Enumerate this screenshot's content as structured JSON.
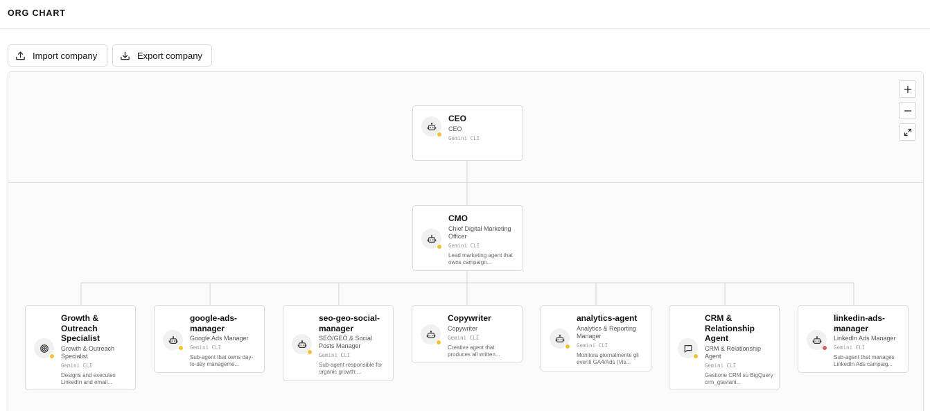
{
  "header": {
    "title": "ORG CHART"
  },
  "toolbar": {
    "import_label": "Import company",
    "export_label": "Export company",
    "import_icon": "upload-icon",
    "export_icon": "download-icon"
  },
  "zoom_controls": {
    "zoom_in_icon": "plus-icon",
    "zoom_out_icon": "minus-icon",
    "fit_icon": "expand-icon"
  },
  "colors": {
    "status_idle": "#f2c230",
    "status_error": "#e05a5a",
    "card_border": "#dadada",
    "canvas_bg": "#fafafa"
  },
  "nodes": [
    {
      "name": "CEO",
      "role": "CEO",
      "adapter": "Gemini CLI",
      "description": "",
      "icon": "bot-icon",
      "status_color": "#f2c230"
    },
    {
      "name": "CMO",
      "role": "Chief Digital Marketing Officer",
      "adapter": "Gemini CLI",
      "description": "Lead marketing agent that owns campaign...",
      "icon": "bot-icon",
      "status_color": "#f2c230"
    },
    {
      "name": "Growth & Outreach Specialist",
      "role": "Growth & Outreach Specialist",
      "adapter": "Gemini CLI",
      "description": "Designs and executes LinkedIn and email...",
      "icon": "target-icon",
      "status_color": "#f2c230"
    },
    {
      "name": "google-ads-manager",
      "role": "Google Ads Manager",
      "adapter": "Gemini CLI",
      "description": "Sub-agent that owns day-to-day manageme...",
      "icon": "bot-icon",
      "status_color": "#f2c230"
    },
    {
      "name": "seo-geo-social-manager",
      "role": "SEO/GEO & Social Posts Manager",
      "adapter": "Gemini CLI",
      "description": "Sub-agent responsible for organic growth:...",
      "icon": "bot-icon",
      "status_color": "#f2c230"
    },
    {
      "name": "Copywriter",
      "role": "Copywriter",
      "adapter": "Gemini CLI",
      "description": "Creative agent that produces all written...",
      "icon": "bot-icon",
      "status_color": "#f2c230"
    },
    {
      "name": "analytics-agent",
      "role": "Analytics & Reporting Manager",
      "adapter": "Gemini CLI",
      "description": "Monitora giornalmente gli eventi GA4/Ads (Vis...",
      "icon": "bot-icon",
      "status_color": "#f2c230"
    },
    {
      "name": "CRM & Relationship Agent",
      "role": "CRM & Relationship Agent",
      "adapter": "Gemini CLI",
      "description": "Gestione CRM su BigQuery crm_gtaviani...",
      "icon": "message-icon",
      "status_color": "#f2c230"
    },
    {
      "name": "linkedin-ads-manager",
      "role": "LinkedIn Ads Manager",
      "adapter": "Gemini CLI",
      "description": "Sub-agent that manages LinkedIn Ads campaig...",
      "icon": "bot-icon",
      "status_color": "#e05a5a"
    }
  ]
}
